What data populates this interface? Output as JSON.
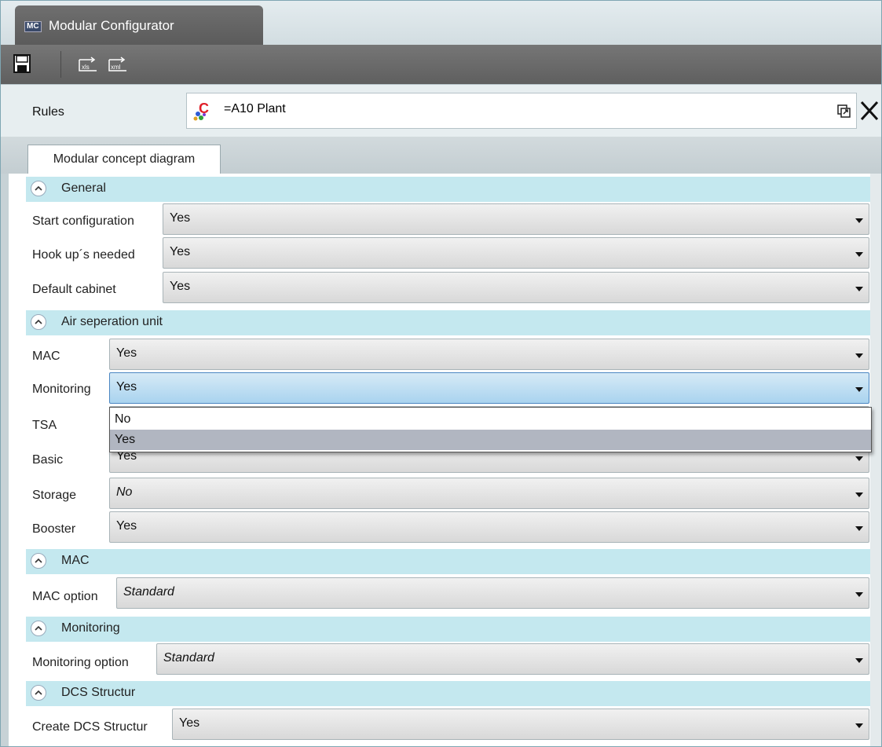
{
  "window": {
    "badge": "MC",
    "title": "Modular Configurator"
  },
  "toolbar": {
    "export_xls": "xls",
    "export_xml": "xml"
  },
  "rules": {
    "label": "Rules",
    "value": "=A10   Plant"
  },
  "tabs": [
    {
      "label": "Modular concept diagram"
    }
  ],
  "sections": {
    "general": {
      "title": "General",
      "rows": [
        {
          "label": "Start configuration",
          "value": "Yes"
        },
        {
          "label": "Hook up´s needed",
          "value": "Yes"
        },
        {
          "label": "Default cabinet",
          "value": "Yes"
        }
      ]
    },
    "air": {
      "title": "Air seperation unit",
      "rows": [
        {
          "label": "MAC",
          "value": "Yes"
        },
        {
          "label": "Monitoring",
          "value": "Yes"
        },
        {
          "label": "TSA",
          "value": ""
        },
        {
          "label": "Basic",
          "value": "Yes"
        },
        {
          "label": "Storage",
          "value": "No"
        },
        {
          "label": "Booster",
          "value": "Yes"
        }
      ]
    },
    "mac": {
      "title": "MAC",
      "rows": [
        {
          "label": "MAC option",
          "value": "Standard"
        }
      ]
    },
    "monitoring": {
      "title": "Monitoring",
      "rows": [
        {
          "label": "Monitoring option",
          "value": "Standard"
        }
      ]
    },
    "dcs": {
      "title": "DCS Structur",
      "rows": [
        {
          "label": "Create DCS Structur",
          "value": "Yes"
        }
      ]
    }
  },
  "dropdown": {
    "options": [
      {
        "label": "No"
      },
      {
        "label": "Yes"
      }
    ],
    "selected": "Yes"
  },
  "colors": {
    "section_header": "#c4e8ef",
    "focus": "#a9d3ef",
    "selected_option": "#b1b6c1"
  }
}
